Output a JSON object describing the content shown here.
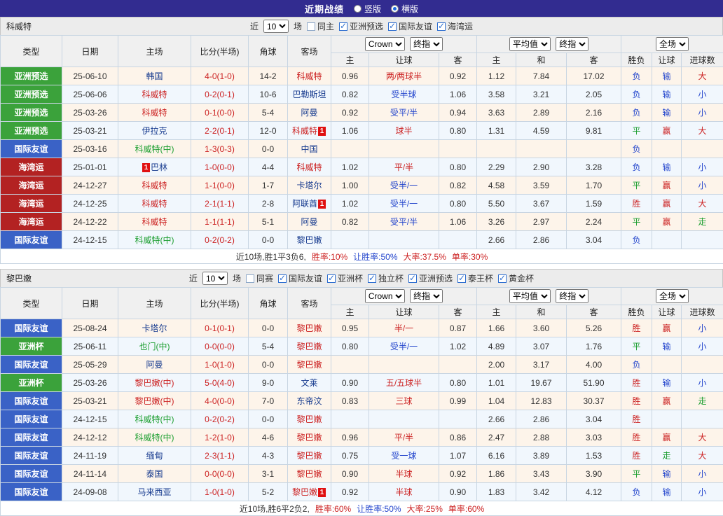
{
  "topbar": {
    "title": "近期战绩",
    "vertical": "竖版",
    "horizontal": "横版"
  },
  "filter": {
    "near": "近",
    "count": "10",
    "games": "场"
  },
  "header": {
    "type": "类型",
    "date": "日期",
    "home": "主场",
    "score": "比分(半场)",
    "corner": "角球",
    "away": "客场",
    "odds_company": "Crown",
    "odds_stage": "终指",
    "avg_company": "平均值",
    "avg_stage": "终指",
    "scope": "全场",
    "o_home": "主",
    "o_hc": "让球",
    "o_away": "客",
    "a_home": "主",
    "a_draw": "和",
    "a_away": "客",
    "result": "胜负",
    "hc_result": "让球",
    "goals": "进球数"
  },
  "sections": [
    {
      "team": "科威特",
      "filters": [
        {
          "label": "同主",
          "checked": false
        },
        {
          "label": "亚洲预选",
          "checked": true
        },
        {
          "label": "国际友谊",
          "checked": true
        },
        {
          "label": "海湾运",
          "checked": true
        }
      ],
      "rows": [
        {
          "type": "亚洲预选",
          "type_color": "green",
          "date": "25-06-10",
          "home": {
            "name": "韩国",
            "color": "navy"
          },
          "score": "4-0(1-0)",
          "corner": "14-2",
          "away": {
            "name": "科威特",
            "color": "red"
          },
          "odds": {
            "home": "0.96",
            "hc": "两/两球半",
            "hc_color": "red",
            "away": "0.92"
          },
          "avg": {
            "home": "1.12",
            "draw": "7.84",
            "away": "17.02"
          },
          "result": {
            "text": "负",
            "color": "blue"
          },
          "hc_result": {
            "text": "输",
            "color": "blue"
          },
          "goals": {
            "text": "大",
            "color": "red"
          }
        },
        {
          "type": "亚洲预选",
          "type_color": "green",
          "date": "25-06-06",
          "home": {
            "name": "科威特",
            "color": "red"
          },
          "score": "0-2(0-1)",
          "corner": "10-6",
          "away": {
            "name": "巴勒斯坦",
            "color": "navy"
          },
          "odds": {
            "home": "0.82",
            "hc": "受半球",
            "hc_color": "blue",
            "away": "1.06"
          },
          "avg": {
            "home": "3.58",
            "draw": "3.21",
            "away": "2.05"
          },
          "result": {
            "text": "负",
            "color": "blue"
          },
          "hc_result": {
            "text": "输",
            "color": "blue"
          },
          "goals": {
            "text": "小",
            "color": "blue"
          }
        },
        {
          "type": "亚洲预选",
          "type_color": "green",
          "date": "25-03-26",
          "home": {
            "name": "科威特",
            "color": "red"
          },
          "score": "0-1(0-0)",
          "corner": "5-4",
          "away": {
            "name": "阿曼",
            "color": "navy"
          },
          "odds": {
            "home": "0.92",
            "hc": "受平/半",
            "hc_color": "blue",
            "away": "0.94"
          },
          "avg": {
            "home": "3.63",
            "draw": "2.89",
            "away": "2.16"
          },
          "result": {
            "text": "负",
            "color": "blue"
          },
          "hc_result": {
            "text": "输",
            "color": "blue"
          },
          "goals": {
            "text": "小",
            "color": "blue"
          }
        },
        {
          "type": "亚洲预选",
          "type_color": "green",
          "date": "25-03-21",
          "home": {
            "name": "伊拉克",
            "color": "navy"
          },
          "score": "2-2(0-1)",
          "corner": "12-0",
          "away": {
            "name": "科威特",
            "color": "red",
            "badge": "1",
            "badge_pos": "after"
          },
          "odds": {
            "home": "1.06",
            "hc": "球半",
            "hc_color": "red",
            "away": "0.80"
          },
          "avg": {
            "home": "1.31",
            "draw": "4.59",
            "away": "9.81"
          },
          "result": {
            "text": "平",
            "color": "green"
          },
          "hc_result": {
            "text": "赢",
            "color": "red"
          },
          "goals": {
            "text": "大",
            "color": "red"
          }
        },
        {
          "type": "国际友谊",
          "type_color": "blue",
          "date": "25-03-16",
          "home": {
            "name": "科威特(中)",
            "color": "green"
          },
          "score": "1-3(0-3)",
          "corner": "0-0",
          "away": {
            "name": "中国",
            "color": "navy"
          },
          "odds": {
            "home": "",
            "hc": "",
            "hc_color": "red",
            "away": ""
          },
          "avg": {
            "home": "",
            "draw": "",
            "away": ""
          },
          "result": {
            "text": "负",
            "color": "blue"
          },
          "hc_result": {
            "text": "",
            "color": "blue"
          },
          "goals": {
            "text": "",
            "color": "blue"
          }
        },
        {
          "type": "海湾运",
          "type_color": "darkred",
          "date": "25-01-01",
          "home": {
            "name": "巴林",
            "color": "navy",
            "badge": "1",
            "badge_pos": "before"
          },
          "score": "1-0(0-0)",
          "corner": "4-4",
          "away": {
            "name": "科威特",
            "color": "red"
          },
          "odds": {
            "home": "1.02",
            "hc": "平/半",
            "hc_color": "red",
            "away": "0.80"
          },
          "avg": {
            "home": "2.29",
            "draw": "2.90",
            "away": "3.28"
          },
          "result": {
            "text": "负",
            "color": "blue"
          },
          "hc_result": {
            "text": "输",
            "color": "blue"
          },
          "goals": {
            "text": "小",
            "color": "blue"
          }
        },
        {
          "type": "海湾运",
          "type_color": "darkred",
          "date": "24-12-27",
          "home": {
            "name": "科威特",
            "color": "red"
          },
          "score": "1-1(0-0)",
          "corner": "1-7",
          "away": {
            "name": "卡塔尔",
            "color": "navy"
          },
          "odds": {
            "home": "1.00",
            "hc": "受半/一",
            "hc_color": "blue",
            "away": "0.82"
          },
          "avg": {
            "home": "4.58",
            "draw": "3.59",
            "away": "1.70"
          },
          "result": {
            "text": "平",
            "color": "green"
          },
          "hc_result": {
            "text": "赢",
            "color": "red"
          },
          "goals": {
            "text": "小",
            "color": "blue"
          }
        },
        {
          "type": "海湾运",
          "type_color": "darkred",
          "date": "24-12-25",
          "home": {
            "name": "科威特",
            "color": "red"
          },
          "score": "2-1(1-1)",
          "corner": "2-8",
          "away": {
            "name": "阿联酋",
            "color": "navy",
            "badge": "1",
            "badge_pos": "after"
          },
          "odds": {
            "home": "1.02",
            "hc": "受半/一",
            "hc_color": "blue",
            "away": "0.80"
          },
          "avg": {
            "home": "5.50",
            "draw": "3.67",
            "away": "1.59"
          },
          "result": {
            "text": "胜",
            "color": "red"
          },
          "hc_result": {
            "text": "赢",
            "color": "red"
          },
          "goals": {
            "text": "大",
            "color": "red"
          }
        },
        {
          "type": "海湾运",
          "type_color": "darkred",
          "date": "24-12-22",
          "home": {
            "name": "科威特",
            "color": "red"
          },
          "score": "1-1(1-1)",
          "corner": "5-1",
          "away": {
            "name": "阿曼",
            "color": "navy"
          },
          "odds": {
            "home": "0.82",
            "hc": "受平/半",
            "hc_color": "blue",
            "away": "1.06"
          },
          "avg": {
            "home": "3.26",
            "draw": "2.97",
            "away": "2.24"
          },
          "result": {
            "text": "平",
            "color": "green"
          },
          "hc_result": {
            "text": "赢",
            "color": "red"
          },
          "goals": {
            "text": "走",
            "color": "green"
          }
        },
        {
          "type": "国际友谊",
          "type_color": "blue",
          "date": "24-12-15",
          "home": {
            "name": "科威特(中)",
            "color": "green"
          },
          "score": "0-2(0-2)",
          "corner": "0-0",
          "away": {
            "name": "黎巴嫩",
            "color": "navy"
          },
          "odds": {
            "home": "",
            "hc": "",
            "hc_color": "red",
            "away": ""
          },
          "avg": {
            "home": "2.66",
            "draw": "2.86",
            "away": "3.04"
          },
          "result": {
            "text": "负",
            "color": "blue"
          },
          "hc_result": {
            "text": "",
            "color": "blue"
          },
          "goals": {
            "text": "",
            "color": "blue"
          }
        }
      ],
      "summary": [
        {
          "text": "近10场,胜1平3负6,",
          "color": "black"
        },
        {
          "text": "胜率:10%",
          "color": "red"
        },
        {
          "text": "让胜率:50%",
          "color": "blue"
        },
        {
          "text": "大率:37.5%",
          "color": "red"
        },
        {
          "text": "单率:30%",
          "color": "red"
        }
      ]
    },
    {
      "team": "黎巴嫩",
      "filters": [
        {
          "label": "同赛",
          "checked": false
        },
        {
          "label": "国际友谊",
          "checked": true
        },
        {
          "label": "亚洲杯",
          "checked": true
        },
        {
          "label": "独立杯",
          "checked": true
        },
        {
          "label": "亚洲预选",
          "checked": true
        },
        {
          "label": "泰王杯",
          "checked": true
        },
        {
          "label": "黄金杯",
          "checked": true
        }
      ],
      "rows": [
        {
          "type": "国际友谊",
          "type_color": "blue",
          "date": "25-08-24",
          "home": {
            "name": "卡塔尔",
            "color": "navy"
          },
          "score": "0-1(0-1)",
          "corner": "0-0",
          "away": {
            "name": "黎巴嫩",
            "color": "red"
          },
          "odds": {
            "home": "0.95",
            "hc": "半/一",
            "hc_color": "red",
            "away": "0.87"
          },
          "avg": {
            "home": "1.66",
            "draw": "3.60",
            "away": "5.26"
          },
          "result": {
            "text": "胜",
            "color": "red"
          },
          "hc_result": {
            "text": "赢",
            "color": "red"
          },
          "goals": {
            "text": "小",
            "color": "blue"
          }
        },
        {
          "type": "亚洲杯",
          "type_color": "green",
          "date": "25-06-11",
          "home": {
            "name": "也门(中)",
            "color": "green"
          },
          "score": "0-0(0-0)",
          "corner": "5-4",
          "away": {
            "name": "黎巴嫩",
            "color": "red"
          },
          "odds": {
            "home": "0.80",
            "hc": "受半/一",
            "hc_color": "blue",
            "away": "1.02"
          },
          "avg": {
            "home": "4.89",
            "draw": "3.07",
            "away": "1.76"
          },
          "result": {
            "text": "平",
            "color": "green"
          },
          "hc_result": {
            "text": "输",
            "color": "blue"
          },
          "goals": {
            "text": "小",
            "color": "blue"
          }
        },
        {
          "type": "国际友谊",
          "type_color": "blue",
          "date": "25-05-29",
          "home": {
            "name": "阿曼",
            "color": "navy"
          },
          "score": "1-0(1-0)",
          "corner": "0-0",
          "away": {
            "name": "黎巴嫩",
            "color": "red"
          },
          "odds": {
            "home": "",
            "hc": "",
            "hc_color": "red",
            "away": ""
          },
          "avg": {
            "home": "2.00",
            "draw": "3.17",
            "away": "4.00"
          },
          "result": {
            "text": "负",
            "color": "blue"
          },
          "hc_result": {
            "text": "",
            "color": "blue"
          },
          "goals": {
            "text": "",
            "color": "blue"
          }
        },
        {
          "type": "亚洲杯",
          "type_color": "green",
          "date": "25-03-26",
          "home": {
            "name": "黎巴嫩(中)",
            "color": "red"
          },
          "score": "5-0(4-0)",
          "corner": "9-0",
          "away": {
            "name": "文莱",
            "color": "navy"
          },
          "odds": {
            "home": "0.90",
            "hc": "五/五球半",
            "hc_color": "red",
            "away": "0.80"
          },
          "avg": {
            "home": "1.01",
            "draw": "19.67",
            "away": "51.90"
          },
          "result": {
            "text": "胜",
            "color": "red"
          },
          "hc_result": {
            "text": "输",
            "color": "blue"
          },
          "goals": {
            "text": "小",
            "color": "blue"
          }
        },
        {
          "type": "国际友谊",
          "type_color": "blue",
          "date": "25-03-21",
          "home": {
            "name": "黎巴嫩(中)",
            "color": "red"
          },
          "score": "4-0(0-0)",
          "corner": "7-0",
          "away": {
            "name": "东帝汶",
            "color": "navy"
          },
          "odds": {
            "home": "0.83",
            "hc": "三球",
            "hc_color": "red",
            "away": "0.99"
          },
          "avg": {
            "home": "1.04",
            "draw": "12.83",
            "away": "30.37"
          },
          "result": {
            "text": "胜",
            "color": "red"
          },
          "hc_result": {
            "text": "赢",
            "color": "red"
          },
          "goals": {
            "text": "走",
            "color": "green"
          }
        },
        {
          "type": "国际友谊",
          "type_color": "blue",
          "date": "24-12-15",
          "home": {
            "name": "科威特(中)",
            "color": "green"
          },
          "score": "0-2(0-2)",
          "corner": "0-0",
          "away": {
            "name": "黎巴嫩",
            "color": "red"
          },
          "odds": {
            "home": "",
            "hc": "",
            "hc_color": "red",
            "away": ""
          },
          "avg": {
            "home": "2.66",
            "draw": "2.86",
            "away": "3.04"
          },
          "result": {
            "text": "胜",
            "color": "red"
          },
          "hc_result": {
            "text": "",
            "color": "blue"
          },
          "goals": {
            "text": "",
            "color": "blue"
          }
        },
        {
          "type": "国际友谊",
          "type_color": "blue",
          "date": "24-12-12",
          "home": {
            "name": "科威特(中)",
            "color": "green"
          },
          "score": "1-2(1-0)",
          "corner": "4-6",
          "away": {
            "name": "黎巴嫩",
            "color": "red"
          },
          "odds": {
            "home": "0.96",
            "hc": "平/半",
            "hc_color": "red",
            "away": "0.86"
          },
          "avg": {
            "home": "2.47",
            "draw": "2.88",
            "away": "3.03"
          },
          "result": {
            "text": "胜",
            "color": "red"
          },
          "hc_result": {
            "text": "赢",
            "color": "red"
          },
          "goals": {
            "text": "大",
            "color": "red"
          }
        },
        {
          "type": "国际友谊",
          "type_color": "blue",
          "date": "24-11-19",
          "home": {
            "name": "缅甸",
            "color": "navy"
          },
          "score": "2-3(1-1)",
          "corner": "4-3",
          "away": {
            "name": "黎巴嫩",
            "color": "red"
          },
          "odds": {
            "home": "0.75",
            "hc": "受一球",
            "hc_color": "blue",
            "away": "1.07"
          },
          "avg": {
            "home": "6.16",
            "draw": "3.89",
            "away": "1.53"
          },
          "result": {
            "text": "胜",
            "color": "red"
          },
          "hc_result": {
            "text": "走",
            "color": "green"
          },
          "goals": {
            "text": "大",
            "color": "red"
          }
        },
        {
          "type": "国际友谊",
          "type_color": "blue",
          "date": "24-11-14",
          "home": {
            "name": "泰国",
            "color": "navy"
          },
          "score": "0-0(0-0)",
          "corner": "3-1",
          "away": {
            "name": "黎巴嫩",
            "color": "red"
          },
          "odds": {
            "home": "0.90",
            "hc": "半球",
            "hc_color": "red",
            "away": "0.92"
          },
          "avg": {
            "home": "1.86",
            "draw": "3.43",
            "away": "3.90"
          },
          "result": {
            "text": "平",
            "color": "green"
          },
          "hc_result": {
            "text": "输",
            "color": "blue"
          },
          "goals": {
            "text": "小",
            "color": "blue"
          }
        },
        {
          "type": "国际友谊",
          "type_color": "blue",
          "date": "24-09-08",
          "home": {
            "name": "马来西亚",
            "color": "navy"
          },
          "score": "1-0(1-0)",
          "corner": "5-2",
          "away": {
            "name": "黎巴嫩",
            "color": "red",
            "badge": "1",
            "badge_pos": "after"
          },
          "odds": {
            "home": "0.92",
            "hc": "半球",
            "hc_color": "red",
            "away": "0.90"
          },
          "avg": {
            "home": "1.83",
            "draw": "3.42",
            "away": "4.12"
          },
          "result": {
            "text": "负",
            "color": "blue"
          },
          "hc_result": {
            "text": "输",
            "color": "blue"
          },
          "goals": {
            "text": "小",
            "color": "blue"
          }
        }
      ],
      "summary": [
        {
          "text": "近10场,胜6平2负2,",
          "color": "black"
        },
        {
          "text": "胜率:60%",
          "color": "red"
        },
        {
          "text": "让胜率:50%",
          "color": "blue"
        },
        {
          "text": "大率:25%",
          "color": "red"
        },
        {
          "text": "单率:60%",
          "color": "red"
        }
      ]
    }
  ]
}
